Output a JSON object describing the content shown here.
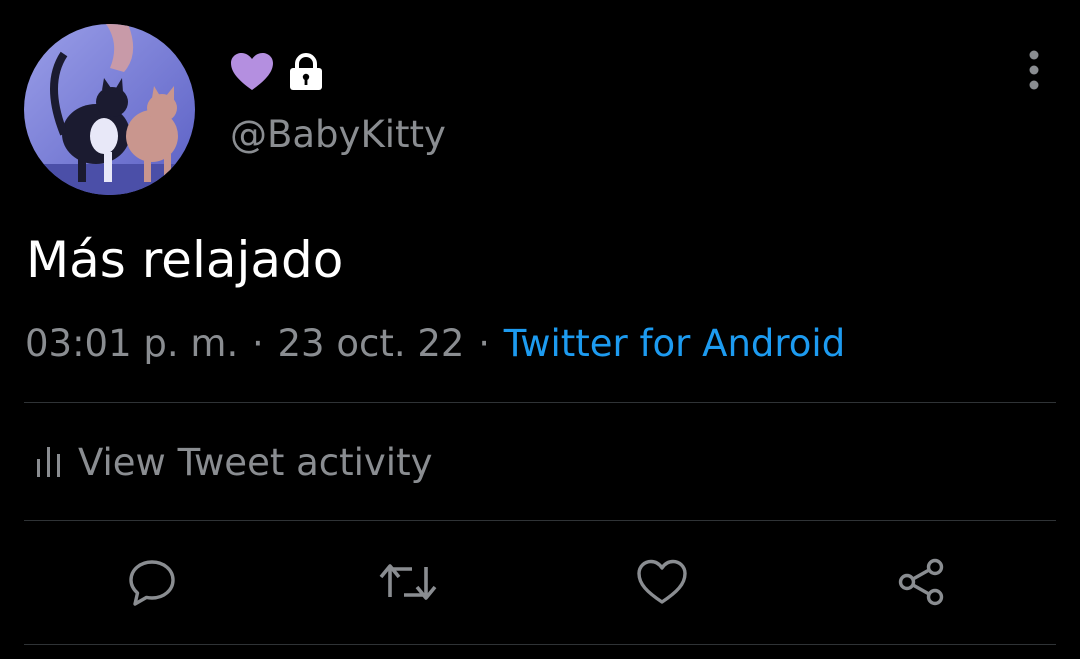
{
  "tweet": {
    "handle": "@BabyKitty",
    "text": "Más relajado",
    "time": "03:01 p. m.",
    "separator": "·",
    "date": "23 oct. 22",
    "source": "Twitter for Android"
  },
  "name_icons": [
    "purple-heart-icon",
    "lock-icon"
  ],
  "activity": {
    "label": "View Tweet activity",
    "icon": "bar-chart-icon"
  },
  "actions": [
    {
      "icon": "reply-icon"
    },
    {
      "icon": "retweet-icon"
    },
    {
      "icon": "like-icon"
    },
    {
      "icon": "share-icon"
    }
  ],
  "colors": {
    "background": "#000000",
    "text_primary": "#ffffff",
    "text_secondary": "#8a8d91",
    "link": "#1d9bf0",
    "heart": "#b48fe0",
    "divider": "#2f3336"
  }
}
